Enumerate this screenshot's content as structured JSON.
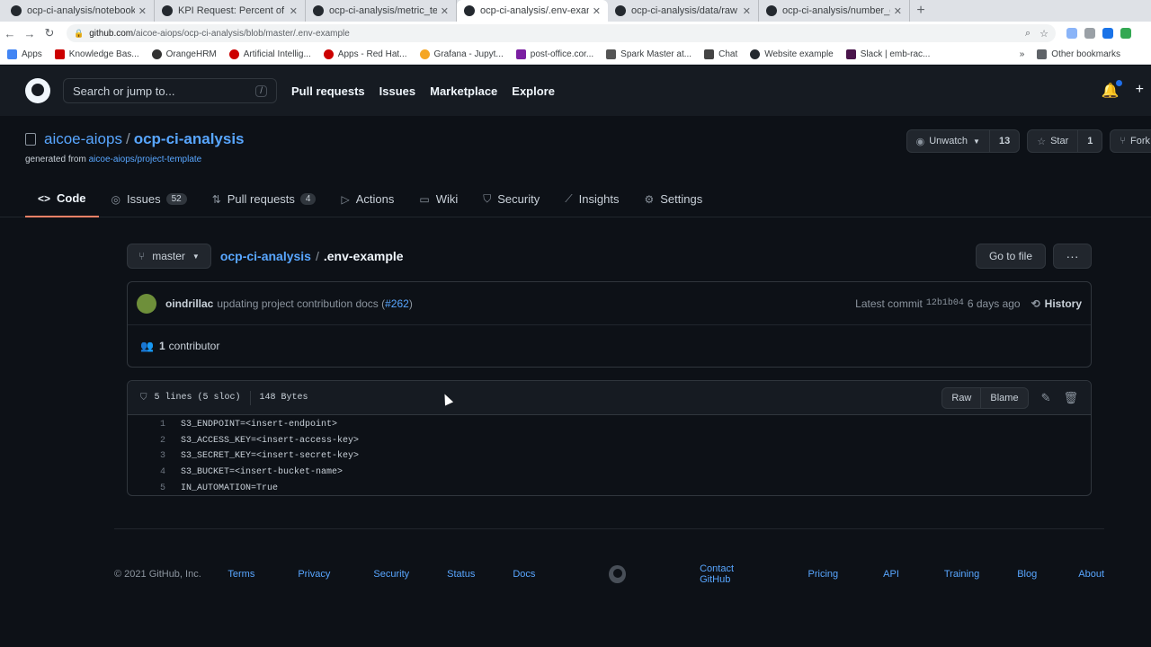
{
  "browser": {
    "tabs": [
      {
        "label": "ocp-ci-analysis/notebooks",
        "active": false
      },
      {
        "label": "KPI Request: Percent of Fla",
        "active": false
      },
      {
        "label": "ocp-ci-analysis/metric_tem",
        "active": false
      },
      {
        "label": "ocp-ci-analysis/.env-examp",
        "active": true
      },
      {
        "label": "ocp-ci-analysis/data/raw at",
        "active": false
      },
      {
        "label": "ocp-ci-analysis/number_of",
        "active": false
      }
    ],
    "new_tab": "+",
    "url_host": "github.com",
    "url_path": "/aicoe-aiops/ocp-ci-analysis/blob/master/.env-example",
    "bookmarks": [
      {
        "label": "Apps",
        "color": "#4285f4"
      },
      {
        "label": "Knowledge Bas...",
        "color": "#cc0000"
      },
      {
        "label": "OrangeHRM",
        "color": "#333333"
      },
      {
        "label": "Artificial Intellig...",
        "color": "#cc0000"
      },
      {
        "label": "Apps - Red Hat...",
        "color": "#cc0000"
      },
      {
        "label": "Grafana - Jupyt...",
        "color": "#f5a623"
      },
      {
        "label": "post-office.cor...",
        "color": "#7b1fa2"
      },
      {
        "label": "Spark Master at...",
        "color": "#555555"
      },
      {
        "label": "Chat",
        "color": "#444444"
      },
      {
        "label": "Website example",
        "color": "#24292f"
      },
      {
        "label": "Slack | emb-rac...",
        "color": "#4a154b"
      }
    ],
    "other_bookmarks": "Other bookmarks",
    "overflow": "»"
  },
  "gh": {
    "search_placeholder": "Search or jump to...",
    "search_key": "/",
    "nav": [
      "Pull requests",
      "Issues",
      "Marketplace",
      "Explore"
    ]
  },
  "repo": {
    "owner": "aicoe-aiops",
    "separator": "/",
    "name": "ocp-ci-analysis",
    "generated_prefix": "generated from",
    "generated_link": "aicoe-aiops/project-template",
    "unwatch_label": "Unwatch",
    "watch_count": "13",
    "star_label": "Star",
    "star_count": "1",
    "fork_label": "Fork",
    "tabs": [
      {
        "label": "Code",
        "icon": "code-icon",
        "glyph": "<>",
        "count": ""
      },
      {
        "label": "Issues",
        "icon": "issue-icon",
        "glyph": "◎",
        "count": "52"
      },
      {
        "label": "Pull requests",
        "icon": "pull-request-icon",
        "glyph": "⇅",
        "count": "4"
      },
      {
        "label": "Actions",
        "icon": "play-icon",
        "glyph": "▷",
        "count": ""
      },
      {
        "label": "Wiki",
        "icon": "book-icon",
        "glyph": "▭",
        "count": ""
      },
      {
        "label": "Security",
        "icon": "shield-icon",
        "glyph": "⛉",
        "count": ""
      },
      {
        "label": "Insights",
        "icon": "graph-icon",
        "glyph": "⟋",
        "count": ""
      },
      {
        "label": "Settings",
        "icon": "gear-icon",
        "glyph": "⚙",
        "count": ""
      }
    ]
  },
  "file": {
    "branch": "master",
    "crumb_repo": "ocp-ci-analysis",
    "crumb_sep": "/",
    "crumb_file": ".env-example",
    "goto_label": "Go to file",
    "more_label": "···",
    "commit_author": "oindrillac",
    "commit_message": "updating project contribution docs (",
    "commit_pr": "#262",
    "commit_close": ")",
    "latest_label": "Latest commit",
    "commit_sha": "12b1b04",
    "commit_age": "6 days ago",
    "history_label": "History",
    "contributors_count": "1",
    "contributors_label": "contributor",
    "lines_info": "5 lines (5 sloc)",
    "size_info": "148 Bytes",
    "raw_label": "Raw",
    "blame_label": "Blame",
    "lines": [
      {
        "n": "1",
        "code": "S3_ENDPOINT=<insert-endpoint>"
      },
      {
        "n": "2",
        "code": "S3_ACCESS_KEY=<insert-access-key>"
      },
      {
        "n": "3",
        "code": "S3_SECRET_KEY=<insert-secret-key>"
      },
      {
        "n": "4",
        "code": "S3_BUCKET=<insert-bucket-name>"
      },
      {
        "n": "5",
        "code": "IN_AUTOMATION=True"
      }
    ]
  },
  "footer": {
    "copyright": "© 2021 GitHub, Inc.",
    "left_links": [
      "Terms",
      "Privacy",
      "Security",
      "Status",
      "Docs"
    ],
    "right_links": [
      "Contact GitHub",
      "Pricing",
      "API",
      "Training",
      "Blog",
      "About"
    ]
  }
}
